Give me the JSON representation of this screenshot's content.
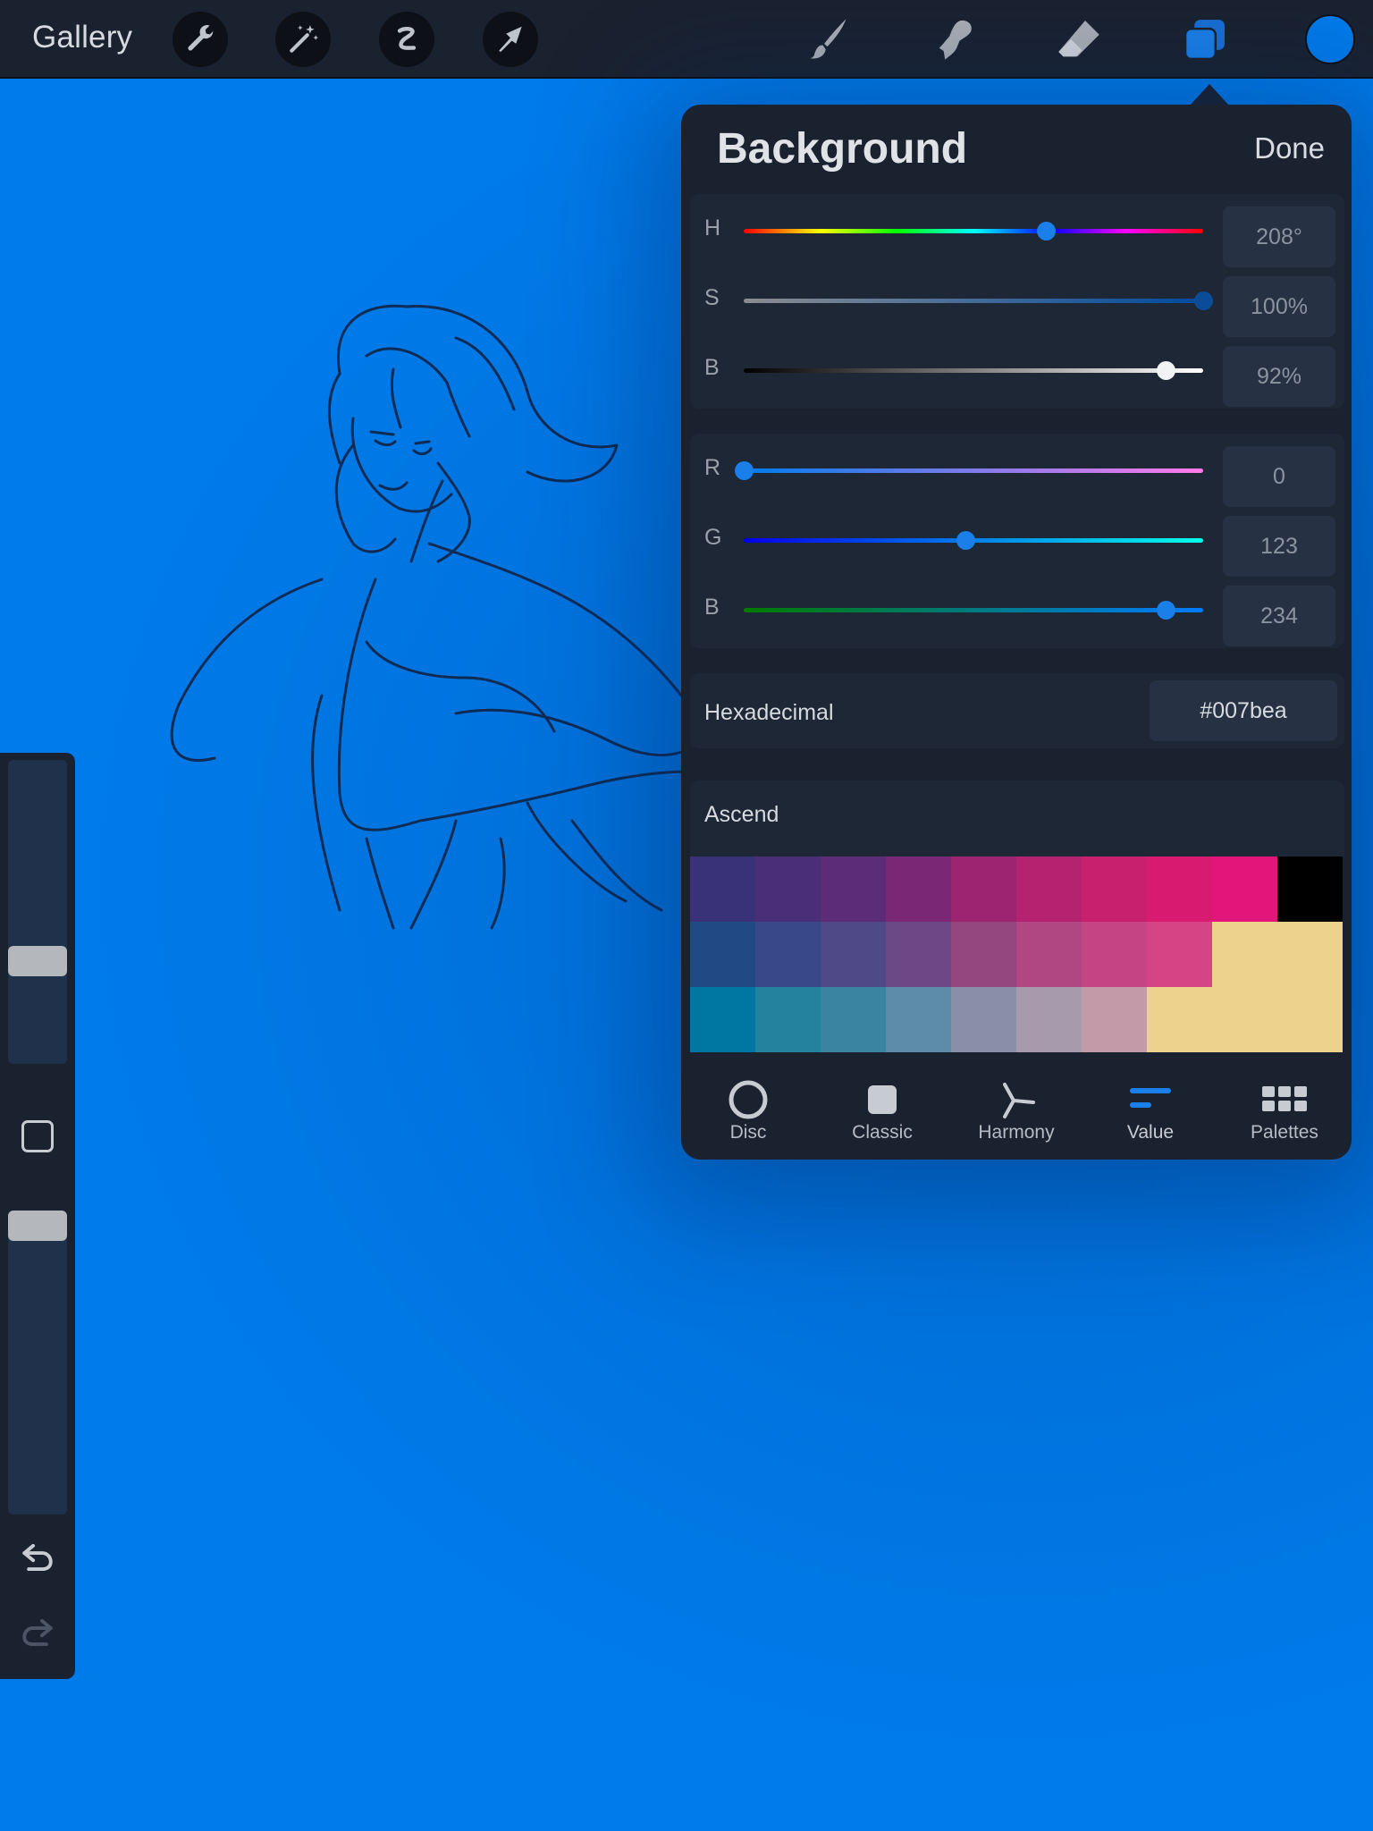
{
  "topbar": {
    "gallery_label": "Gallery",
    "left_tools": [
      "wrench-icon",
      "magic-wand-icon",
      "selection-s-icon",
      "transform-arrow-icon"
    ],
    "right_tools": [
      "brush-icon",
      "smudge-icon",
      "eraser-icon",
      "layers-icon"
    ],
    "current_color": "#007bea"
  },
  "sidebar": {
    "size_level": 0.65,
    "opacity_level": 0.05
  },
  "color_panel": {
    "title": "Background",
    "done_label": "Done",
    "hsb": [
      {
        "label": "H",
        "value": "208°",
        "level": 0.658
      },
      {
        "label": "S",
        "value": "100%",
        "level": 1.0
      },
      {
        "label": "B",
        "value": "92%",
        "level": 0.918
      }
    ],
    "rgb": [
      {
        "label": "R",
        "value": "0",
        "level": 0.0
      },
      {
        "label": "G",
        "value": "123",
        "level": 0.482
      },
      {
        "label": "B",
        "value": "234",
        "level": 0.918
      }
    ],
    "hex_label": "Hexadecimal",
    "hex_value": "#007bea",
    "palette_name": "Ascend",
    "palette_rows": [
      [
        "#3a3278",
        "#4a2f78",
        "#5c2c78",
        "#7a2876",
        "#9c2470",
        "#b52270",
        "#c81f6e",
        "#d81b71",
        "#e2157a",
        "#000000"
      ],
      [
        "#214a85",
        "#384888",
        "#4f4988",
        "#6c4886",
        "#94477f",
        "#b14782",
        "#c44583",
        "#d54485",
        "#ecd28c",
        "#ecd28c"
      ],
      [
        "#0077a3",
        "#23839f",
        "#3a84a2",
        "#5d8ca8",
        "#8a8fa8",
        "#a79aad",
        "#c39aa8",
        "#ecd28c",
        "#ecd28c",
        "#ecd28c"
      ]
    ],
    "tabs": [
      {
        "label": "Disc",
        "icon": "disc-icon"
      },
      {
        "label": "Classic",
        "icon": "classic-square-icon"
      },
      {
        "label": "Harmony",
        "icon": "harmony-icon"
      },
      {
        "label": "Value",
        "icon": "value-sliders-icon",
        "active": true
      },
      {
        "label": "Palettes",
        "icon": "palettes-grid-icon"
      }
    ]
  },
  "colors": {
    "accent": "#1a7fe8",
    "panel_bg": "#1a2230",
    "canvas": "#007bea"
  }
}
